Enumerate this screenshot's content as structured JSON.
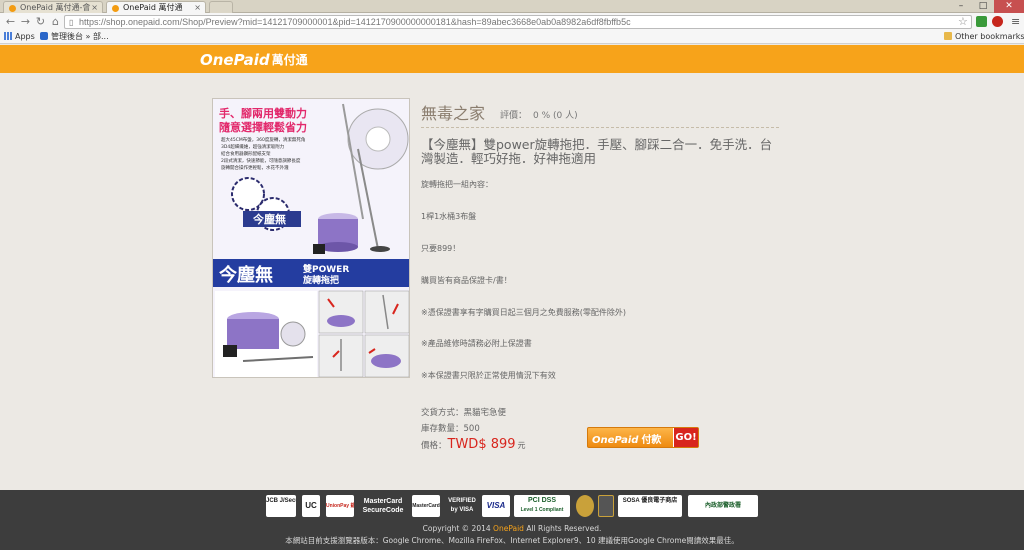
{
  "browser": {
    "tabs": [
      {
        "label": "OnePaid 萬付通-會",
        "active": false
      },
      {
        "label": "OnePaid 萬付通",
        "active": true
      }
    ],
    "url_host": "https://shop.onepaid.com",
    "url_path": "/Shop/Preview?mid=14121709000001&pid=1412170900000000181&hash=89abec3668e0ab0a8982a6df8fbffb5c",
    "bookmarks": {
      "apps": "Apps",
      "admin": "管理後台 » 部...",
      "other": "Other bookmarks"
    }
  },
  "site": {
    "logo_latin": "OnePaid",
    "logo_cn": "萬付通"
  },
  "product": {
    "store_name": "無毒之家",
    "rating_label": "評價：",
    "rating_value": "0 % (0 人)",
    "title": "【今塵無】雙power旋轉拖把．手壓、腳踩二合一．免手洗．台灣製造．輕巧好拖．好神拖適用",
    "description": [
      "旋轉拖把一組內容：",
      "1桿1水桶3布盤",
      "只要899！",
      "購買皆有商品保證卡/書！",
      "※憑保證書享有字購買日起三個月之免費服務(零配件除外)",
      "※產品維修時請務必附上保證書",
      "※本保證書只限於正常使用情況下有效"
    ],
    "shipping": "交貨方式：黑貓宅急便",
    "stock": "庫存數量：500",
    "price_label": "價格：",
    "price": "TWD$ 899",
    "price_unit": "元",
    "image": {
      "headline1": "手、腳兩用雙動力",
      "headline2": "隨意選擇輕鬆省力",
      "bullets": [
        "超大45CM布盤，360度旋轉，清潔無死角",
        "3D4超細纖維，超強清潔吸附力",
        "結合食用器鑽形配紙支架",
        "2段式清潔，快速節能，可隨意調節長度",
        "旋轉開合操作更輕鬆，水花不外濺"
      ],
      "brand": "今塵無",
      "product_line": "雙POWER",
      "product_type": "旋轉拖把"
    },
    "pay_button": {
      "label_latin": "OnePaid",
      "label_cn": "付款",
      "go": "GO!"
    }
  },
  "footer": {
    "card_logos": [
      "JCB J/Secure",
      "UC",
      "UnionPay 銀聯",
      "MasterCard SecureCode",
      "MasterCard",
      "VERIFIED by VISA",
      "VISA",
      "PCI DSS",
      "Level 1 Compliant",
      "SOSA 優良電子商店",
      "內政部警政署"
    ],
    "copyright_prefix": "Copyright © 2014",
    "copyright_brand": "OnePaid",
    "copyright_suffix": "All Rights Reserved.",
    "support": "本網站目前支援瀏覽器版本：Google Chrome、Mozilla FireFox、Internet Explorer9、10 建議使用Google Chrome閱讀效果最佳。"
  }
}
